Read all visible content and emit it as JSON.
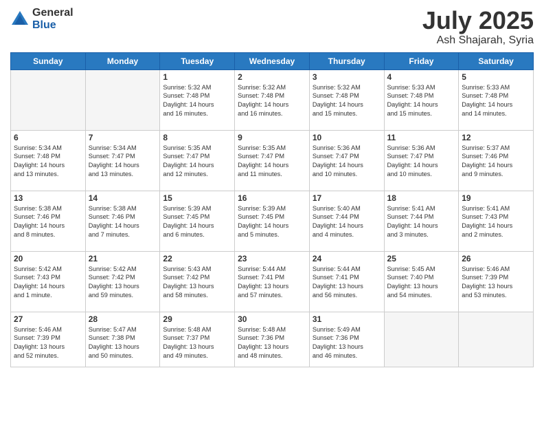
{
  "logo": {
    "general": "General",
    "blue": "Blue"
  },
  "title": "July 2025",
  "location": "Ash Shajarah, Syria",
  "days_header": [
    "Sunday",
    "Monday",
    "Tuesday",
    "Wednesday",
    "Thursday",
    "Friday",
    "Saturday"
  ],
  "weeks": [
    [
      {
        "day": "",
        "info": ""
      },
      {
        "day": "",
        "info": ""
      },
      {
        "day": "1",
        "info": "Sunrise: 5:32 AM\nSunset: 7:48 PM\nDaylight: 14 hours\nand 16 minutes."
      },
      {
        "day": "2",
        "info": "Sunrise: 5:32 AM\nSunset: 7:48 PM\nDaylight: 14 hours\nand 16 minutes."
      },
      {
        "day": "3",
        "info": "Sunrise: 5:32 AM\nSunset: 7:48 PM\nDaylight: 14 hours\nand 15 minutes."
      },
      {
        "day": "4",
        "info": "Sunrise: 5:33 AM\nSunset: 7:48 PM\nDaylight: 14 hours\nand 15 minutes."
      },
      {
        "day": "5",
        "info": "Sunrise: 5:33 AM\nSunset: 7:48 PM\nDaylight: 14 hours\nand 14 minutes."
      }
    ],
    [
      {
        "day": "6",
        "info": "Sunrise: 5:34 AM\nSunset: 7:48 PM\nDaylight: 14 hours\nand 13 minutes."
      },
      {
        "day": "7",
        "info": "Sunrise: 5:34 AM\nSunset: 7:47 PM\nDaylight: 14 hours\nand 13 minutes."
      },
      {
        "day": "8",
        "info": "Sunrise: 5:35 AM\nSunset: 7:47 PM\nDaylight: 14 hours\nand 12 minutes."
      },
      {
        "day": "9",
        "info": "Sunrise: 5:35 AM\nSunset: 7:47 PM\nDaylight: 14 hours\nand 11 minutes."
      },
      {
        "day": "10",
        "info": "Sunrise: 5:36 AM\nSunset: 7:47 PM\nDaylight: 14 hours\nand 10 minutes."
      },
      {
        "day": "11",
        "info": "Sunrise: 5:36 AM\nSunset: 7:47 PM\nDaylight: 14 hours\nand 10 minutes."
      },
      {
        "day": "12",
        "info": "Sunrise: 5:37 AM\nSunset: 7:46 PM\nDaylight: 14 hours\nand 9 minutes."
      }
    ],
    [
      {
        "day": "13",
        "info": "Sunrise: 5:38 AM\nSunset: 7:46 PM\nDaylight: 14 hours\nand 8 minutes."
      },
      {
        "day": "14",
        "info": "Sunrise: 5:38 AM\nSunset: 7:46 PM\nDaylight: 14 hours\nand 7 minutes."
      },
      {
        "day": "15",
        "info": "Sunrise: 5:39 AM\nSunset: 7:45 PM\nDaylight: 14 hours\nand 6 minutes."
      },
      {
        "day": "16",
        "info": "Sunrise: 5:39 AM\nSunset: 7:45 PM\nDaylight: 14 hours\nand 5 minutes."
      },
      {
        "day": "17",
        "info": "Sunrise: 5:40 AM\nSunset: 7:44 PM\nDaylight: 14 hours\nand 4 minutes."
      },
      {
        "day": "18",
        "info": "Sunrise: 5:41 AM\nSunset: 7:44 PM\nDaylight: 14 hours\nand 3 minutes."
      },
      {
        "day": "19",
        "info": "Sunrise: 5:41 AM\nSunset: 7:43 PM\nDaylight: 14 hours\nand 2 minutes."
      }
    ],
    [
      {
        "day": "20",
        "info": "Sunrise: 5:42 AM\nSunset: 7:43 PM\nDaylight: 14 hours\nand 1 minute."
      },
      {
        "day": "21",
        "info": "Sunrise: 5:42 AM\nSunset: 7:42 PM\nDaylight: 13 hours\nand 59 minutes."
      },
      {
        "day": "22",
        "info": "Sunrise: 5:43 AM\nSunset: 7:42 PM\nDaylight: 13 hours\nand 58 minutes."
      },
      {
        "day": "23",
        "info": "Sunrise: 5:44 AM\nSunset: 7:41 PM\nDaylight: 13 hours\nand 57 minutes."
      },
      {
        "day": "24",
        "info": "Sunrise: 5:44 AM\nSunset: 7:41 PM\nDaylight: 13 hours\nand 56 minutes."
      },
      {
        "day": "25",
        "info": "Sunrise: 5:45 AM\nSunset: 7:40 PM\nDaylight: 13 hours\nand 54 minutes."
      },
      {
        "day": "26",
        "info": "Sunrise: 5:46 AM\nSunset: 7:39 PM\nDaylight: 13 hours\nand 53 minutes."
      }
    ],
    [
      {
        "day": "27",
        "info": "Sunrise: 5:46 AM\nSunset: 7:39 PM\nDaylight: 13 hours\nand 52 minutes."
      },
      {
        "day": "28",
        "info": "Sunrise: 5:47 AM\nSunset: 7:38 PM\nDaylight: 13 hours\nand 50 minutes."
      },
      {
        "day": "29",
        "info": "Sunrise: 5:48 AM\nSunset: 7:37 PM\nDaylight: 13 hours\nand 49 minutes."
      },
      {
        "day": "30",
        "info": "Sunrise: 5:48 AM\nSunset: 7:36 PM\nDaylight: 13 hours\nand 48 minutes."
      },
      {
        "day": "31",
        "info": "Sunrise: 5:49 AM\nSunset: 7:36 PM\nDaylight: 13 hours\nand 46 minutes."
      },
      {
        "day": "",
        "info": ""
      },
      {
        "day": "",
        "info": ""
      }
    ]
  ]
}
